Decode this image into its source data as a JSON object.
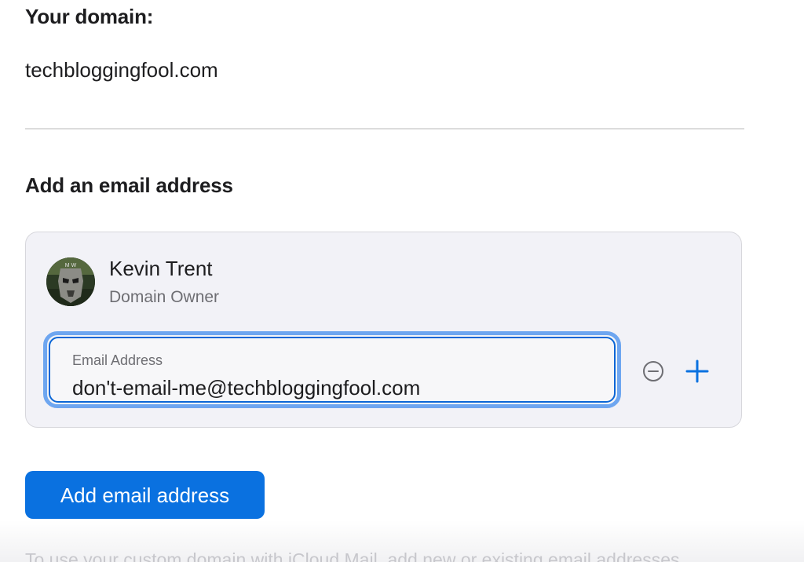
{
  "domain": {
    "heading": "Your domain:",
    "value": "techbloggingfool.com"
  },
  "add_email": {
    "heading": "Add an email address",
    "owner": {
      "name": "Kevin Trent",
      "role": "Domain Owner",
      "avatar": "avatar-image"
    },
    "email_field": {
      "label": "Email Address",
      "value": "don't-email-me@techbloggingfool.com"
    },
    "remove_icon": "minus-circle-icon",
    "add_icon": "plus-icon",
    "button_label": "Add email address"
  },
  "footnote": "To use your custom domain with iCloud Mail, add new or existing email addresses",
  "colors": {
    "accent": "#0a71e0",
    "focus_ring": "#6ea6f0",
    "card_bg": "#f2f2f7"
  }
}
